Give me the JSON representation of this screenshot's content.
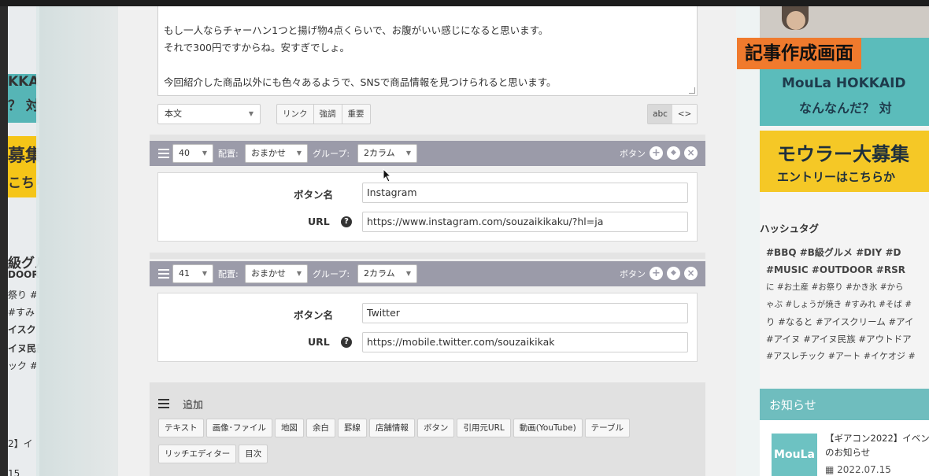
{
  "editor": {
    "body_lines": [
      "もし一人ならチャーハン1つと揚げ物4点くらいで、お腹がいい感じになると思います。",
      "それで300円ですからね。安すぎでしょ。",
      "今回紹介した商品以外にも色々あるようで、SNSで商品情報を見つけられると思います。"
    ],
    "format_select": "本文",
    "format_buttons": [
      "リンク",
      "強調",
      "重要"
    ],
    "mode_buttons": [
      "abc",
      "<>"
    ]
  },
  "blocks": [
    {
      "order": "40",
      "placement_label": "配置:",
      "placement_value": "おまかせ",
      "group_label": "グループ:",
      "group_value": "2カラム",
      "type": "ボタン",
      "name_label": "ボタン名",
      "name_value": "Instagram",
      "url_label": "URL",
      "url_value": "https://www.instagram.com/souzaikikaku/?hl=ja"
    },
    {
      "order": "41",
      "placement_label": "配置:",
      "placement_value": "おまかせ",
      "group_label": "グループ:",
      "group_value": "2カラム",
      "type": "ボタン",
      "name_label": "ボタン名",
      "name_value": "Twitter",
      "url_label": "URL",
      "url_value": "https://mobile.twitter.com/souzaikikak"
    }
  ],
  "add": {
    "label": "追加",
    "items": [
      "テキスト",
      "画像･ファイル",
      "地図",
      "余白",
      "罫線",
      "店舗情報",
      "ボタン",
      "引用元URL",
      "動画(YouTube)",
      "テーブル",
      "リッチエディター",
      "目次"
    ]
  },
  "overlay_title": "記事作成画面",
  "sidebar": {
    "banner1_line1": "MouLa HOKKAID",
    "banner1_line2": "なんなんだ？ 対",
    "banner2_line1": "モウラー大募集",
    "banner2_line2": "エントリーはこちらか",
    "hashtag_title": "ハッシュタグ",
    "tag_lines": [
      "#BBQ #B級グルメ #DIY #D",
      "#MUSIC #OUTDOOR #RSR",
      "に #お土産 #お祭り #かき氷 #から",
      "ゃぶ #しょうが焼き #すみれ #そば #",
      "り #なると #アイスクリーム #アイ",
      "#アイヌ #アイヌ民族 #アウトドア",
      "#アスレチック #アート #イケオジ #"
    ],
    "notice_title": "お知らせ",
    "notice_text1": "【ギアコン2022】イベン",
    "notice_text2": "のお知らせ",
    "notice_date": "2022.07.15",
    "logo_text": "MouLa"
  },
  "left_site": {
    "line1": "KKA",
    "line2": "？ 対",
    "line3": "募集",
    "line4": "こちら",
    "line5": "級グル",
    "line6": "DOOR",
    "line7": "祭り #か",
    "line8": "#すみ",
    "line9": "イスク",
    "line10": "イヌ民族",
    "line11": "ック #ア",
    "line12": "2】イ",
    "line13": "15"
  }
}
